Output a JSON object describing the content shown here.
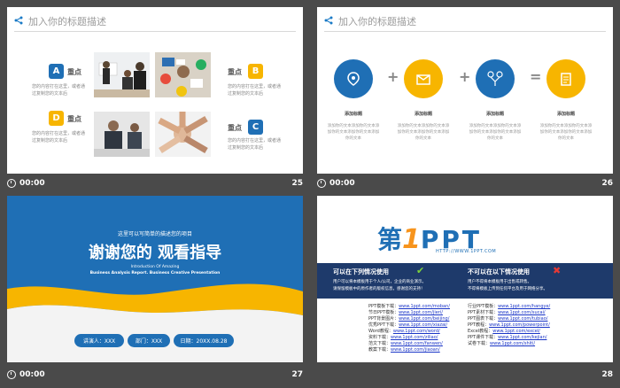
{
  "slide25": {
    "header_title": "加入你的标题描述",
    "badges": [
      "A",
      "B",
      "C",
      "D"
    ],
    "label": "重点",
    "desc": "您的内容打在这里，或者通过复制您的文本后",
    "page_number": "25",
    "time": "00:00"
  },
  "slide26": {
    "header_title": "加入你的标题描述",
    "operators": [
      "+",
      "+",
      "="
    ],
    "item_title": "添加标题",
    "item_desc": "添加你的文本添加你的文本添加你的文本添加你的文本添加你的文本",
    "page_number": "26",
    "time": "00:00"
  },
  "slide27": {
    "kicker": "这里可以写简单的描述您的项目",
    "title": "谢谢您的 观看指导",
    "sub1": "Introduction Of Amazing",
    "sub2": "Business Analysis Report. Business Creative Presentation",
    "pills": [
      "讲演人：XXX",
      "部门：XXX",
      "日期：20XX.08.28"
    ],
    "page_number": "27",
    "time": "00:00"
  },
  "slide28": {
    "logo_prefix": "第",
    "logo_num": "1",
    "logo_suffix": "PPT",
    "logo_url": "HTTP://WWW.1PPT.COM",
    "can_use": "可以在下列情况使用",
    "cannot_use": "不可以在以下情况使用",
    "can_desc1": "用户可以将本模板用于个人/公司，企业的商业演示。",
    "can_desc2": "请保留模板中的原作者的版权信息，感谢您的支持！",
    "cannot_desc1": "用户不得将本模板用于出售或转售。",
    "cannot_desc2": "不得将模板上传到任何平台及用于网络分享。",
    "link_names_left": [
      "PPT模板下载：",
      "节日PPT模板：",
      "PPT背景图片：",
      "优秀PPT下载：",
      "Word教程：",
      "资料下载：",
      "范文下载：",
      "教案下载："
    ],
    "links_left": [
      "www.1ppt.com/moban/",
      "www.1ppt.com/jieri/",
      "www.1ppt.com/beijing/",
      "www.1ppt.com/xiazai/",
      "www.1ppt.com/word/",
      "www.1ppt.com/ziliao/",
      "www.1ppt.com/fanwen/",
      "www.1ppt.com/jiaoan/"
    ],
    "link_names_right": [
      "行业PPT模板：",
      "PPT素材下载：",
      "PPT图表下载：",
      "PPT教程：",
      "Excel教程：",
      "PPT课件下载：",
      "试卷下载："
    ],
    "links_right": [
      "www.1ppt.com/hangye/",
      "www.1ppt.com/sucai/",
      "www.1ppt.com/tubiao/",
      "www.1ppt.com/powerpoint/",
      "www.1ppt.com/excel/",
      "www.1ppt.com/kejian/",
      "www.1ppt.com/shiti/"
    ],
    "page_number": "28",
    "time": "00:00"
  },
  "colors": {
    "blue": "#1f6fb5",
    "yellow": "#f7b500",
    "navy": "#1e3a6b",
    "bg": "#4a4a4a"
  }
}
